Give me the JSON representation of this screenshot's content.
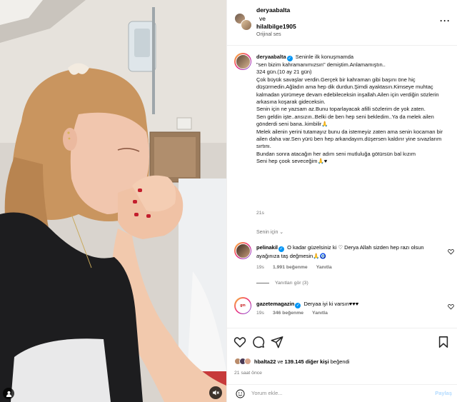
{
  "header": {
    "user1": "deryaabalta",
    "and_label": "ve",
    "user2": "hilalbilge1905",
    "audio": "Orijinal ses",
    "more_icon": "more-horizontal-icon"
  },
  "caption": {
    "username": "deryaabalta",
    "text": " Seninle ilk konuşmamda\n\"sen bizim kahramanımızsın\" demiştim.Anlamamıştın..\n324 gün.(10 ay 21 gün)\nÇok büyük savaşlar verdin.Gerçek bir kahraman gibi başını öne hiç düşürmedin.Ağladın ama hep dik durdun.Şimdi ayaktasın.Kimseye muhtaç kalmadan yürümeye devam edebileceksin inşallah.Ailen için verdiğin sözlerin arkasına koşarak gideceksin.\nSenin için ne yazsam az.Bunu toparlayacak afilli sözlerim de yok zaten.\nSen geldin işte..ansızın..Belki de ben hep seni bekledim..Ya da melek ailen gönderdi seni bana..kimbilir🙏\nMelek ailenin yerini tutamayız bunu da istemeyiz zaten ama senin kocaman bir ailen daha var.Sen yürü ben hep arkandayım.düşersen kaldırır yine sıvazlarım sırtını.\nBundan sonra atacağın her adım seni mutluluğa götürsün bal kızım\nSeni hep çook seveceğim🙏♥",
    "time": "21s",
    "for_you": "Senin için ⌄"
  },
  "comments": [
    {
      "username": "pelinakil",
      "text": " O kadar güzelsiniz ki ♡ Derya Allah sizden hep razı olsun ayağınıza taş değmesin🙏🧿",
      "time": "19s",
      "likes": "1.991 beğenme",
      "reply": "Yanıtla",
      "view_replies": "Yanıtları gör (3)"
    },
    {
      "username": "gazetemagazin",
      "text": " Deryaa iyi ki varsın♥♥♥",
      "time": "19s",
      "likes": "346 beğenme",
      "reply": "Yanıtla"
    }
  ],
  "actions": {
    "like_icon": "heart-icon",
    "comment_icon": "comment-icon",
    "share_icon": "send-icon",
    "save_icon": "bookmark-icon"
  },
  "likes": {
    "user": "hbalta22",
    "connector": " ve ",
    "count": "139.145 diğer kişi",
    "suffix": " beğendi"
  },
  "posted": "21 saat önce",
  "compose": {
    "placeholder": "Yorum ekle...",
    "post": "Paylaş"
  },
  "colors": {
    "verified": "#0095f6",
    "muted_text": "#737373",
    "post_disabled": "#b3dbff",
    "story_ring_start": "#f9ce34",
    "story_ring_end": "#6228d7"
  }
}
